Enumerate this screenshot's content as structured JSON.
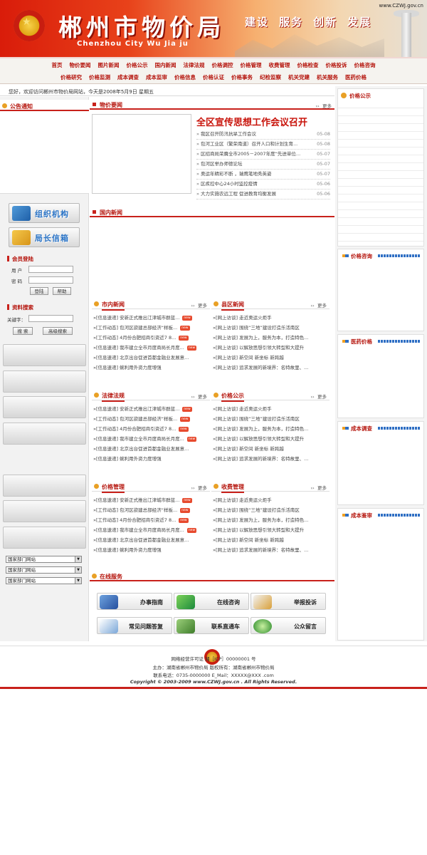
{
  "header": {
    "title": "郴州市物价局",
    "subtitle": "Chenzhou City Wu Jia ju",
    "url": "www.CZWJ.gov.cn",
    "slogans": [
      "建设",
      "服务",
      "创新",
      "发展"
    ]
  },
  "nav": {
    "row1": [
      "首页",
      "物价要闻",
      "图片新闻",
      "价格公示",
      "国内新闻",
      "法律法规",
      "价格调控",
      "价格管理",
      "收费管理",
      "价格检查",
      "价格投诉",
      "价格咨询"
    ],
    "row2": [
      "价格研究",
      "价格监测",
      "成本调查",
      "成本监审",
      "价格信息",
      "价格认证",
      "价格事务",
      "纪检监察",
      "机关党建",
      "机关服务",
      "医药价格"
    ]
  },
  "welcome": "您好，欢迎访问郴州市物价局网站，今天是2008年5月9日  星期五",
  "left": {
    "notice_title": "公告通知",
    "btn_org": "组织机构",
    "btn_mail": "局长信箱",
    "login": {
      "title": "会员登陆",
      "user_label": "用 户",
      "pass_label": "密 码",
      "login_btn": "登陆",
      "help_btn": "帮助"
    },
    "search": {
      "title": "资料搜索",
      "keyword_label": "关键字：",
      "search_btn": "搜 索",
      "adv_btn": "高级搜索"
    },
    "selects": [
      "国家部门网站",
      "国家部门网站",
      "国家部门网站"
    ]
  },
  "center": {
    "wujia": {
      "title": "物价要闻",
      "more": "更多",
      "headline": "全区宣传思想工作会议召开",
      "items": [
        {
          "t": "我区召开防汛抗旱工作会议",
          "d": "05-08"
        },
        {
          "t": "包河工业区（繁荣南道）召开人口和计划生育...",
          "d": "05-08"
        },
        {
          "t": "区招商局荣膺全市2005－2007年度“先进单位...",
          "d": "05-07"
        },
        {
          "t": "包河区举办师德论坛",
          "d": "05-07"
        },
        {
          "t": "奥运年精彩不断 ，瑞鹰笔地秀英姿",
          "d": "05-07"
        },
        {
          "t": "区疾控中心24小时监控疫情",
          "d": "05-06"
        },
        {
          "t": "大力实施农远工程 促进教育均衡发展",
          "d": "05-06"
        }
      ]
    },
    "guonei": {
      "title": "国内新闻"
    },
    "panels": [
      {
        "title": "市内新闻",
        "more": "更多",
        "items": [
          {
            "t": "»[信息速递] 安新正式推出江津城市群蓝...",
            "n": true
          },
          {
            "t": "»[工作动态] 包河区欲建总部经济“样板...",
            "n": true
          },
          {
            "t": "»[工作动态] 4月份合肥招商引资近7 8...",
            "n": true
          },
          {
            "t": "»[信息速递] 我市建立全市月度商局长月度...",
            "n": true
          },
          {
            "t": "»[信息速递] 北京出台促进首都金融业发展意...",
            "n": false
          },
          {
            "t": "»[信息速递] 蜿利用外资力度增强",
            "n": false
          }
        ]
      },
      {
        "title": "县区新闻",
        "more": "更多",
        "items": [
          {
            "t": "»[网上访谈] 走近奥运火炬手"
          },
          {
            "t": "»[网上访谈] 围绕“三地”建设打造乐活南区"
          },
          {
            "t": "»[网上访谈] 发展为上，服务为本，打造特色..."
          },
          {
            "t": "»[网上访谈] 以解放思想引领大转型和大提升"
          },
          {
            "t": "»[网上访谈] 新空间  新坐标  新跨越"
          },
          {
            "t": "»[网上访谈] 追求发展的新境界：名特故里、..."
          }
        ]
      },
      {
        "title": "法律法规",
        "more": "更多",
        "items": [
          {
            "t": "»[信息速递] 安新正式推出江津城市群蓝...",
            "n": true
          },
          {
            "t": "»[工作动态] 包河区欲建总部经济“样板...",
            "n": true
          },
          {
            "t": "»[工作动态] 4月份合肥招商引资近7 8...",
            "n": true
          },
          {
            "t": "»[信息速递] 我市建立全市月度商局长月度...",
            "n": true
          },
          {
            "t": "»[信息速递] 北京出台促进首都金融业发展意...",
            "n": false
          },
          {
            "t": "»[信息速递] 蜿利用外资力度增强",
            "n": false
          }
        ]
      },
      {
        "title": "价格公示",
        "more": "更多",
        "items": [
          {
            "t": "»[网上访谈] 走近奥运火炬手"
          },
          {
            "t": "»[网上访谈] 围绕“三地”建设打造乐活南区"
          },
          {
            "t": "»[网上访谈] 发展为上，服务为本，打造特色..."
          },
          {
            "t": "»[网上访谈] 以解放思想引领大转型和大提升"
          },
          {
            "t": "»[网上访谈] 新空间  新坐标  新跨越"
          },
          {
            "t": "»[网上访谈] 追求发展的新境界：名特故里、..."
          }
        ]
      },
      {
        "title": "价格管理",
        "more": "更多",
        "items": [
          {
            "t": "»[信息速递] 安新正式推出江津城市群蓝...",
            "n": true
          },
          {
            "t": "»[工作动态] 包河区欲建总部经济“样板...",
            "n": true
          },
          {
            "t": "»[工作动态] 4月份合肥招商引资近7 8...",
            "n": true
          },
          {
            "t": "»[信息速递] 我市建立全市月度商局长月度...",
            "n": true
          },
          {
            "t": "»[信息速递] 北京出台促进首都金融业发展意...",
            "n": false
          },
          {
            "t": "»[信息速递] 蜿利用外资力度增强",
            "n": false
          }
        ]
      },
      {
        "title": "收费管理",
        "more": "更多",
        "items": [
          {
            "t": "»[网上访谈] 走近奥运火炬手"
          },
          {
            "t": "»[网上访谈] 围绕“三地”建设打造乐活南区"
          },
          {
            "t": "»[网上访谈] 发展为上，服务为本，打造特色..."
          },
          {
            "t": "»[网上访谈] 以解放思想引领大转型和大提升"
          },
          {
            "t": "»[网上访谈] 新空间  新坐标  新跨越"
          },
          {
            "t": "»[网上访谈] 追求发展的新境界：名特故里、..."
          }
        ]
      }
    ],
    "service": {
      "title": "在线服务",
      "buttons": [
        "办事指南",
        "在线咨询",
        "举报投诉",
        "常见问题答复",
        "联系直通车",
        "公众留言"
      ]
    }
  },
  "right": {
    "boxes": [
      "价格公示",
      "价格咨询",
      "医药价格",
      "成本调查",
      "成本鉴审"
    ]
  },
  "footer": {
    "line1": "网络经营许可证                      湘［ICP］00000001 号",
    "line2": "主办：湖南省郴州市物价局        版权所有：湖南省郴州市物价局",
    "line3": "联系电话：0735-0000000   E_Mail：XXXXX@XXX .com",
    "line4": "Copyright © 2003-2009 www.CZWJ.gov.cn . All Rights Reserved."
  },
  "colors": {
    "brand_red": "#c8211b",
    "nav_text": "#b5140c",
    "headline": "#c8130a"
  }
}
